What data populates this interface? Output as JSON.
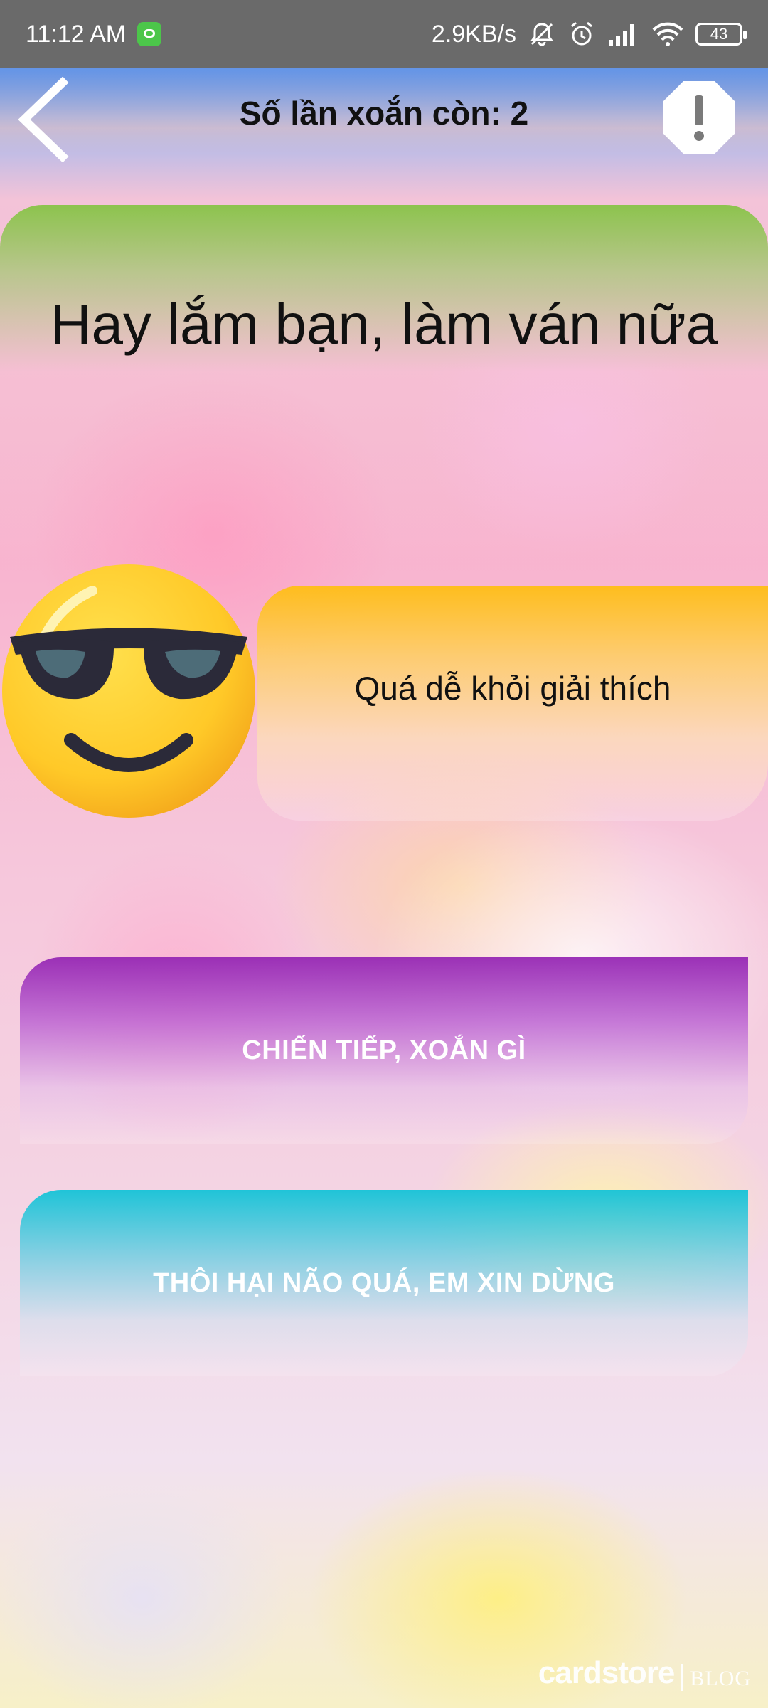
{
  "status_bar": {
    "time": "11:12 AM",
    "speed": "2.9KB/s",
    "battery": "43",
    "icons": [
      "app-notification-icon",
      "mute-bell-icon",
      "alarm-icon",
      "signal-icon",
      "wifi-icon",
      "battery-icon"
    ]
  },
  "header": {
    "title": "Số lần xoắn còn: 2",
    "back_icon": "chevron-left-icon",
    "report_icon": "exclamation-octagon-icon"
  },
  "result": {
    "message": "Hay lắm bạn, làm ván nữa",
    "emoji": "sunglasses-smiley-icon",
    "explanation": "Quá dễ khỏi giải thích"
  },
  "actions": {
    "continue_label": "CHIẾN TIẾP, XOẮN GÌ",
    "stop_label": "THÔI HẠI NÃO QUÁ, EM XIN DỪNG"
  },
  "watermark": {
    "brand": "cardstore",
    "suffix": "BLOG"
  },
  "colors": {
    "result_card": "#8BC34A",
    "explain_card": "#FFC107",
    "continue_button": "#9C27B0",
    "stop_button": "#1CC8D8",
    "status_bar": "#6A6A6A"
  }
}
